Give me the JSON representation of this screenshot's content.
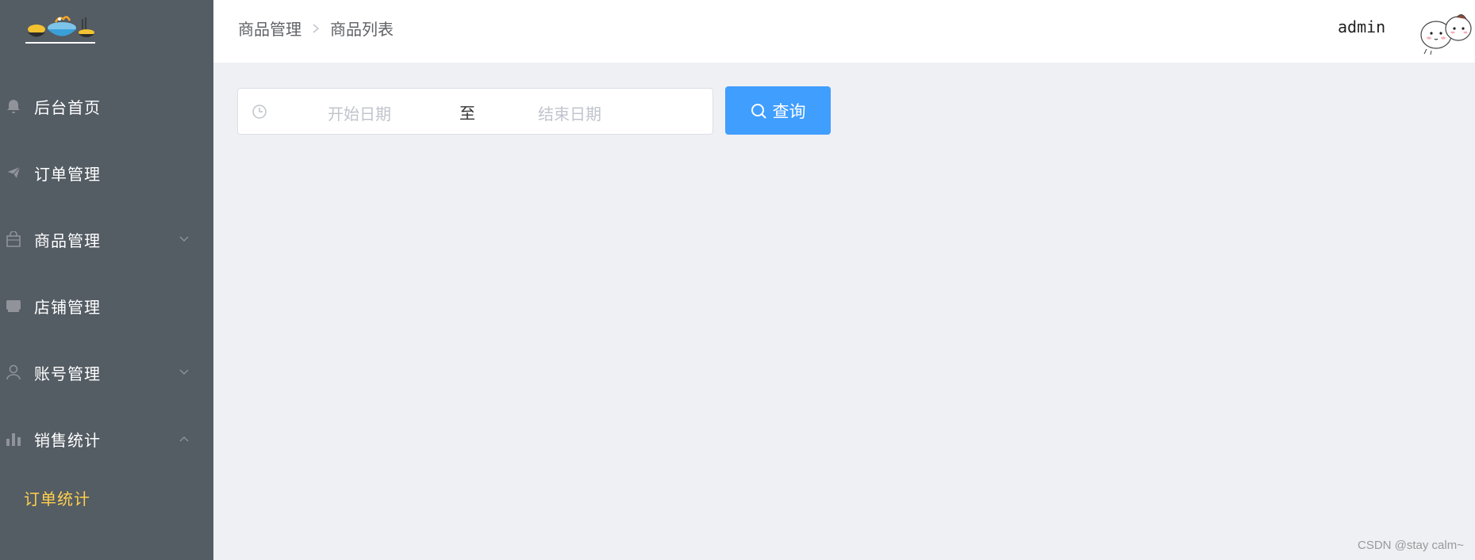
{
  "colors": {
    "sidebar_bg": "#545c64",
    "active_submenu": "#ffd04b",
    "primary": "#409eff",
    "content_bg": "#eff0f4"
  },
  "sidebar": {
    "items": [
      {
        "label": "后台首页",
        "icon": "bell-icon"
      },
      {
        "label": "订单管理",
        "icon": "paper-plane-icon"
      },
      {
        "label": "商品管理",
        "icon": "shopping-bag-icon",
        "expandable": true,
        "expanded": false
      },
      {
        "label": "店铺管理",
        "icon": "shop-icon"
      },
      {
        "label": "账号管理",
        "icon": "user-icon",
        "expandable": true,
        "expanded": false
      },
      {
        "label": "销售统计",
        "icon": "bar-chart-icon",
        "expandable": true,
        "expanded": true,
        "children": [
          {
            "label": "订单统计",
            "active": true
          }
        ]
      }
    ]
  },
  "header": {
    "breadcrumb": [
      "商品管理",
      "商品列表"
    ],
    "user": "admin"
  },
  "filter": {
    "start_placeholder": "开始日期",
    "range_separator": "至",
    "end_placeholder": "结束日期",
    "query_label": "查询"
  },
  "watermark": "CSDN @stay calm~"
}
